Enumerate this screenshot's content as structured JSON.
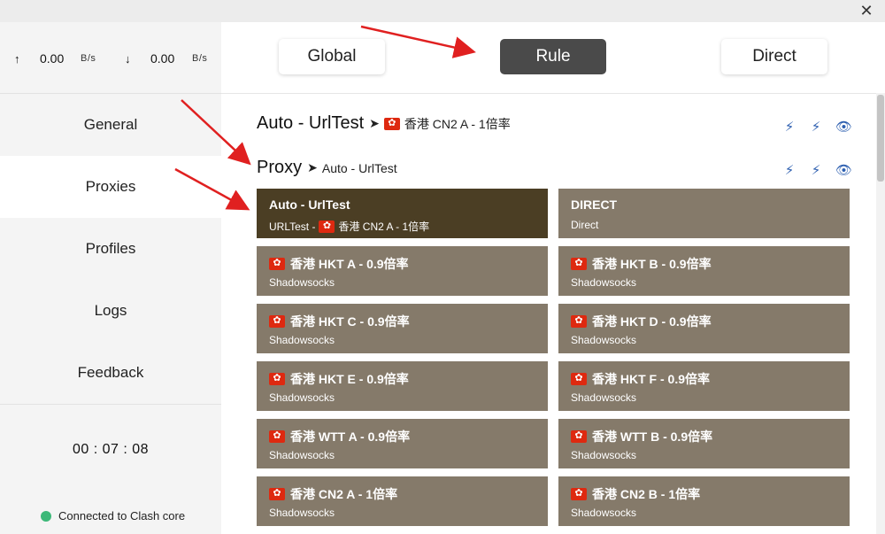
{
  "window": {
    "close_label": "✕"
  },
  "traffic": {
    "up_arrow": "↑",
    "up_value": "0.00",
    "up_unit": "B/s",
    "down_arrow": "↓",
    "down_value": "0.00",
    "down_unit": "B/s"
  },
  "sidebar": {
    "items": [
      {
        "label": "General"
      },
      {
        "label": "Proxies"
      },
      {
        "label": "Profiles"
      },
      {
        "label": "Logs"
      },
      {
        "label": "Feedback"
      }
    ],
    "active": "Proxies",
    "timer": "00 : 07 : 08",
    "status": "Connected to Clash core"
  },
  "modes": {
    "global": "Global",
    "rule": "Rule",
    "direct": "Direct",
    "active": "Rule"
  },
  "groups": [
    {
      "name": "Auto - UrlTest",
      "selected": "香港 CN2 A - 1倍率"
    },
    {
      "name": "Proxy",
      "selected": "Auto - UrlTest"
    }
  ],
  "proxies": [
    {
      "name": "Auto - UrlTest",
      "type_prefix": "URLTest - ",
      "type_suffix": "香港 CN2 A - 1倍率"
    },
    {
      "name": "DIRECT",
      "type": "Direct"
    },
    {
      "name": "香港 HKT A - 0.9倍率",
      "type": "Shadowsocks"
    },
    {
      "name": "香港 HKT B - 0.9倍率",
      "type": "Shadowsocks"
    },
    {
      "name": "香港 HKT C - 0.9倍率",
      "type": "Shadowsocks"
    },
    {
      "name": "香港 HKT D - 0.9倍率",
      "type": "Shadowsocks"
    },
    {
      "name": "香港 HKT E - 0.9倍率",
      "type": "Shadowsocks"
    },
    {
      "name": "香港 HKT F - 0.9倍率",
      "type": "Shadowsocks"
    },
    {
      "name": "香港 WTT A - 0.9倍率",
      "type": "Shadowsocks"
    },
    {
      "name": "香港 WTT B - 0.9倍率",
      "type": "Shadowsocks"
    },
    {
      "name": "香港 CN2 A - 1倍率",
      "type": "Shadowsocks"
    },
    {
      "name": "香港 CN2 B - 1倍率",
      "type": "Shadowsocks"
    }
  ],
  "icons": {
    "latency_test": "bolt-icon",
    "latency_test_alt": "bolt-alt-icon",
    "show": "eye-icon",
    "hide": "eye-off-icon",
    "flag": "hong-kong-flag-icon"
  },
  "colors": {
    "card": "#857a6a",
    "card_selected": "#4b3e24",
    "accent_icon": "#2d5fb0",
    "mode_active": "#4a4a4a",
    "status_ok": "#3cb878",
    "annotation_arrow": "#e02020"
  }
}
